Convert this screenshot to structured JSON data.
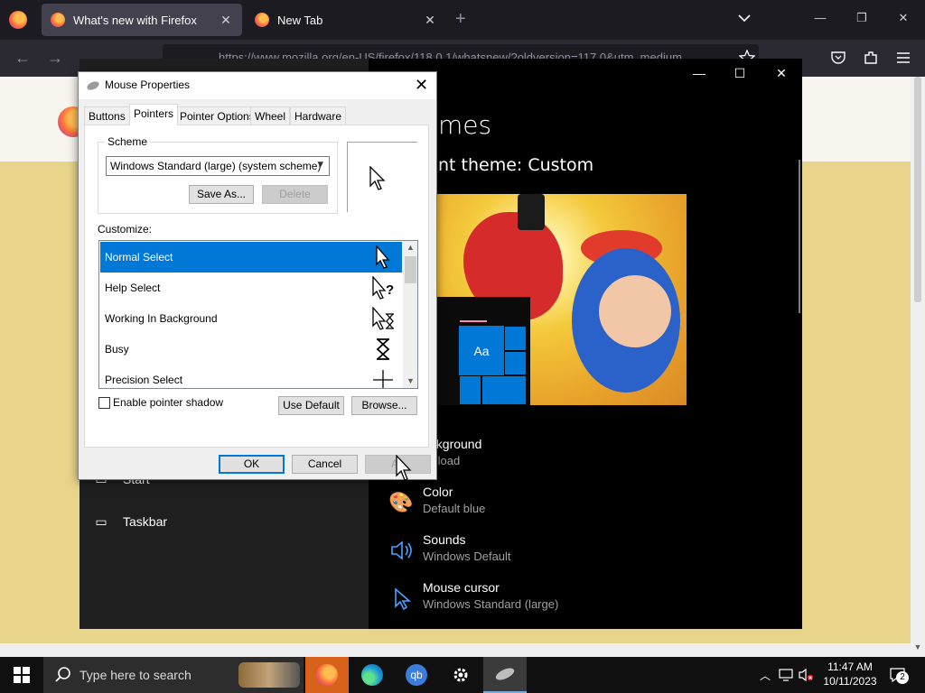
{
  "firefox": {
    "tabs": [
      {
        "title": "What's new with Firefox",
        "active": true
      },
      {
        "title": "New Tab",
        "active": false
      }
    ],
    "new_tab_glyph": "+",
    "url": "https://www.mozilla.org/en-US/firefox/118.0.1/whatsnew/?oldversion=117.0&utm_medium"
  },
  "settings": {
    "title_partial": "mes",
    "current_theme": "nt theme: Custom",
    "nav": [
      {
        "label": "Start",
        "icon": "start-icon"
      },
      {
        "label": "Taskbar",
        "icon": "taskbar-icon"
      }
    ],
    "preview_tile_label": "Aa",
    "options": [
      {
        "title": "ackground",
        "sub": "wnload",
        "icon": "image-icon"
      },
      {
        "title": "Color",
        "sub": "Default blue",
        "icon": "palette-icon"
      },
      {
        "title": "Sounds",
        "sub": "Windows Default",
        "icon": "speaker-icon"
      },
      {
        "title": "Mouse cursor",
        "sub": "Windows Standard (large)",
        "icon": "cursor-icon"
      }
    ]
  },
  "dialog": {
    "title": "Mouse Properties",
    "tabs": [
      "Buttons",
      "Pointers",
      "Pointer Options",
      "Wheel",
      "Hardware"
    ],
    "selected_tab": "Pointers",
    "scheme_label": "Scheme",
    "scheme_value": "Windows Standard (large) (system scheme)",
    "save_as": "Save As...",
    "delete": "Delete",
    "customize_label": "Customize:",
    "cursors": [
      {
        "name": "Normal Select",
        "icon": "arrow-cursor-icon",
        "selected": true
      },
      {
        "name": "Help Select",
        "icon": "help-cursor-icon",
        "selected": false
      },
      {
        "name": "Working In Background",
        "icon": "working-cursor-icon",
        "selected": false
      },
      {
        "name": "Busy",
        "icon": "hourglass-cursor-icon",
        "selected": false
      },
      {
        "name": "Precision Select",
        "icon": "crosshair-cursor-icon",
        "selected": false
      }
    ],
    "enable_shadow": "Enable pointer shadow",
    "shadow_checked": false,
    "use_default": "Use Default",
    "browse": "Browse...",
    "ok": "OK",
    "cancel": "Cancel",
    "apply": "Ap"
  },
  "taskbar": {
    "search_placeholder": "Type here to search",
    "apps": [
      "firefox-icon",
      "edge-icon",
      "qbittorrent-icon",
      "settings-gear-icon",
      "mouse-icon"
    ],
    "qb_label": "qb",
    "time": "11:47 AM",
    "date": "10/11/2023",
    "notification_count": "2"
  }
}
